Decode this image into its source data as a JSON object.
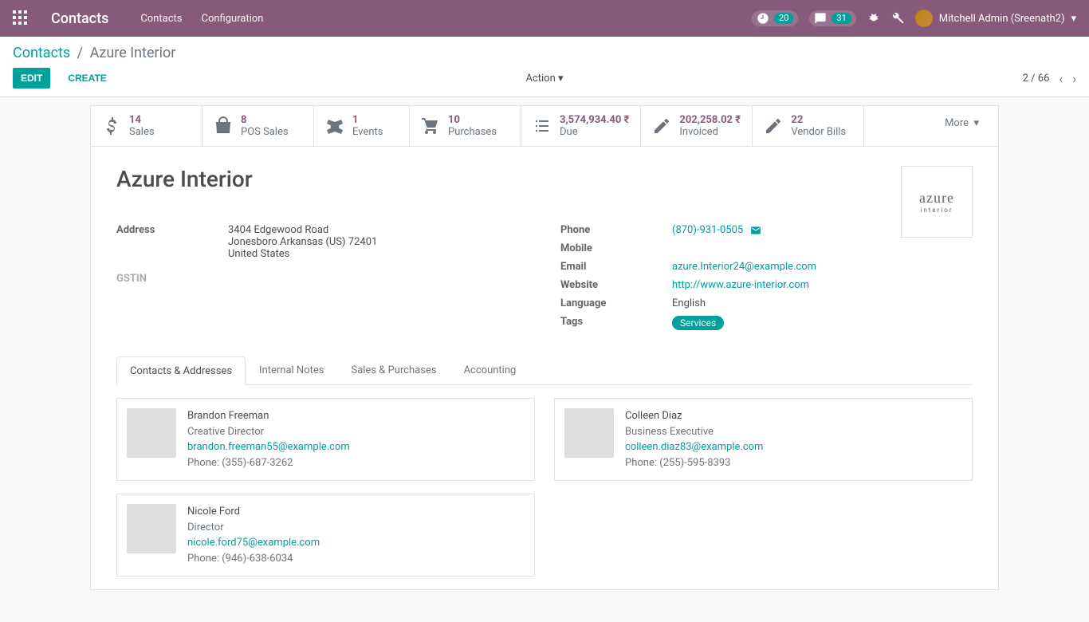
{
  "topbar": {
    "app_title": "Contacts",
    "nav": [
      "Contacts",
      "Configuration"
    ],
    "activity_count": "20",
    "message_count": "31",
    "user_name": "Mitchell Admin (Sreenath2)"
  },
  "breadcrumb": {
    "root": "Contacts",
    "current": "Azure Interior"
  },
  "buttons": {
    "edit": "EDIT",
    "create": "CREATE",
    "action": "Action",
    "more": "More"
  },
  "pager": {
    "text": "2 / 66"
  },
  "stats": [
    {
      "value": "14",
      "label": "Sales"
    },
    {
      "value": "8",
      "label": "POS Sales"
    },
    {
      "value": "1",
      "label": "Events"
    },
    {
      "value": "10",
      "label": "Purchases"
    },
    {
      "value": "3,574,934.40 ₹",
      "label": "Due"
    },
    {
      "value": "202,258.02 ₹",
      "label": "Invoiced"
    },
    {
      "value": "22",
      "label": "Vendor Bills"
    }
  ],
  "record": {
    "name": "Azure Interior",
    "logo_text": "azure",
    "logo_sub": "interior",
    "address": {
      "label": "Address",
      "street": "3404 Edgewood Road",
      "city_line": "Jonesboro  Arkansas (US)  72401",
      "country": "United States"
    },
    "gstin_label": "GSTIN",
    "phone_label": "Phone",
    "phone": "(870)-931-0505",
    "mobile_label": "Mobile",
    "email_label": "Email",
    "email": "azure.Interior24@example.com",
    "website_label": "Website",
    "website": "http://www.azure-interior.com",
    "language_label": "Language",
    "language": "English",
    "tags_label": "Tags",
    "tag": "Services"
  },
  "tabs": [
    "Contacts & Addresses",
    "Internal Notes",
    "Sales & Purchases",
    "Accounting"
  ],
  "contacts": [
    {
      "name": "Brandon Freeman",
      "title": "Creative Director",
      "email": "brandon.freeman55@example.com",
      "phone": "Phone: (355)-687-3262",
      "avatar": "av1"
    },
    {
      "name": "Colleen Diaz",
      "title": "Business Executive",
      "email": "colleen.diaz83@example.com",
      "phone": "Phone: (255)-595-8393",
      "avatar": "av2"
    },
    {
      "name": "Nicole Ford",
      "title": "Director",
      "email": "nicole.ford75@example.com",
      "phone": "Phone: (946)-638-6034",
      "avatar": "av3"
    }
  ]
}
